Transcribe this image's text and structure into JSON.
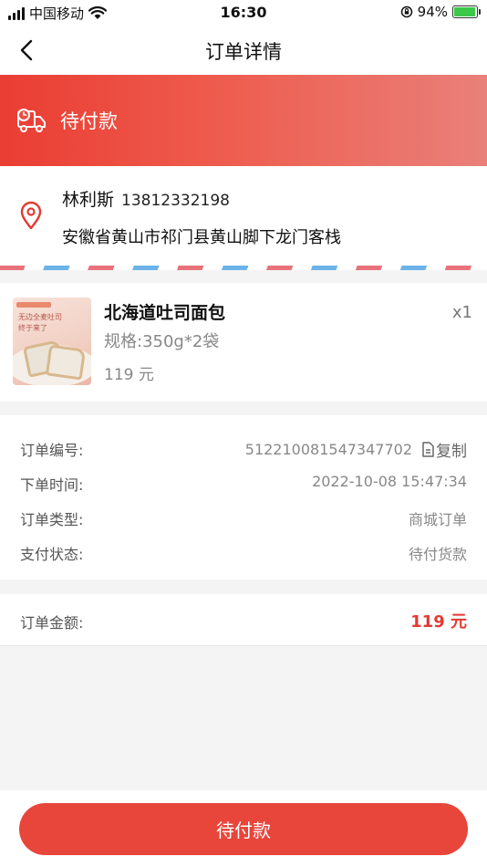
{
  "status_bar": {
    "carrier": "中国移动",
    "time": "16:30",
    "battery_percent": "94%",
    "battery_level": 0.94,
    "icons": [
      "signal-icon",
      "wifi-icon",
      "orientation-lock-icon",
      "battery-icon"
    ]
  },
  "nav": {
    "title": "订单详情",
    "back_icon": "back-arrow-icon"
  },
  "banner": {
    "status_text": "待付款",
    "icon": "delivery-truck-clock-icon"
  },
  "address": {
    "name": "林利斯",
    "phone": "13812332198",
    "full_address": "安徽省黄山市祁门县黄山脚下龙门客栈",
    "icon": "location-pin-icon"
  },
  "product": {
    "name": "北海道吐司面包",
    "spec": "规格:350g*2袋",
    "price": "119 元",
    "quantity": "x1",
    "image_text_line1": "无边全麦吐司",
    "image_text_line2": "终于来了"
  },
  "order_info": {
    "rows": [
      {
        "label": "订单编号:",
        "value": "512210081547347702"
      },
      {
        "label": "下单时间:",
        "value": "2022-10-08 15:47:34"
      },
      {
        "label": "订单类型:",
        "value": "商城订单"
      },
      {
        "label": "支付状态:",
        "value": "待付货款"
      }
    ],
    "copy_label": "复制"
  },
  "amount": {
    "label": "订单金额:",
    "value": "119 元"
  },
  "bottom": {
    "button_label": "待付款"
  },
  "colors": {
    "accent": "#e8453b",
    "price_red": "#e23a32",
    "banner_start": "#ea3d33",
    "banner_end": "#e9807a"
  }
}
